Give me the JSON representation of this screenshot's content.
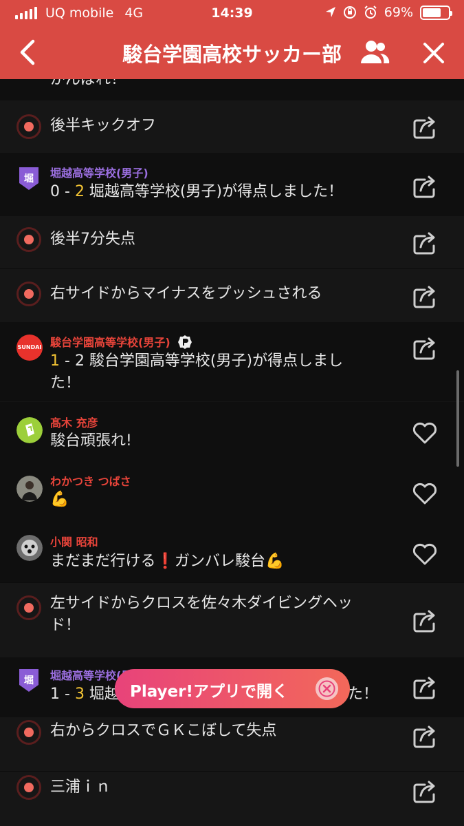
{
  "status_bar": {
    "carrier": "UQ mobile",
    "network": "4G",
    "time": "14:39",
    "battery": "69%",
    "battery_level": 0.69,
    "icons": [
      "location-icon",
      "orientation-lock-icon",
      "alarm-icon"
    ]
  },
  "header": {
    "title": "駿台学園高校サッカー部",
    "back_icon": "chevron-left-icon",
    "members_icon": "people-icon",
    "close_icon": "close-icon",
    "color": "#d94a43"
  },
  "feed": {
    "top_partial_text": "がんばれ！",
    "items": [
      {
        "kind": "event",
        "text": "後半キックオフ"
      },
      {
        "kind": "goal",
        "team": "堀越高等学校(男子)",
        "team_badge": "堀",
        "score_left": "0",
        "score_sep": " - ",
        "score_right": "2",
        "score_text": " 堀越高等学校(男子)が得点しました！"
      },
      {
        "kind": "event",
        "text": "後半7分失点"
      },
      {
        "kind": "event",
        "text": "右サイドからマイナスをプッシュされる"
      },
      {
        "kind": "goal",
        "team": "駿台学園高等学校(男子)",
        "team_badge": "SUNDAI",
        "score_left": "1",
        "score_sep": " - ",
        "score_right": "2",
        "score_text_line1": " 駿台学園高等学校(男子)が得点しまし",
        "score_text_line2": "た！"
      },
      {
        "kind": "comment",
        "user": "髙木 充彦",
        "text": "駿台頑張れ!"
      },
      {
        "kind": "comment",
        "user": "わかつき つばさ",
        "text": "💪"
      },
      {
        "kind": "comment",
        "user": "小関 昭和",
        "text": "まだまだ行ける❗️ガンバレ駿台💪"
      },
      {
        "kind": "event",
        "text_line1": "左サイドからクロスを佐々木ダイビングヘッ",
        "text_line2": "ド！"
      },
      {
        "kind": "goal",
        "team": "堀越高等学校(男子)",
        "team_badge": "堀",
        "score_left": "1",
        "score_sep": " - ",
        "score_right": "3",
        "score_text_visible_start": " 堀越",
        "score_text_visible_end": "た！"
      },
      {
        "kind": "event",
        "text": "右からクロスでＧＫこぼして失点"
      },
      {
        "kind": "event",
        "text": "三浦ｉｎ"
      }
    ]
  },
  "open_app_pill": {
    "label": "Player!アプリで開く",
    "close_icon": "close-circle-icon"
  },
  "colors": {
    "team_horikoshi": "#9b6fe0",
    "team_sundai": "#e8443a",
    "user_name": "#e8443a",
    "score_highlight": "#f4c534"
  }
}
